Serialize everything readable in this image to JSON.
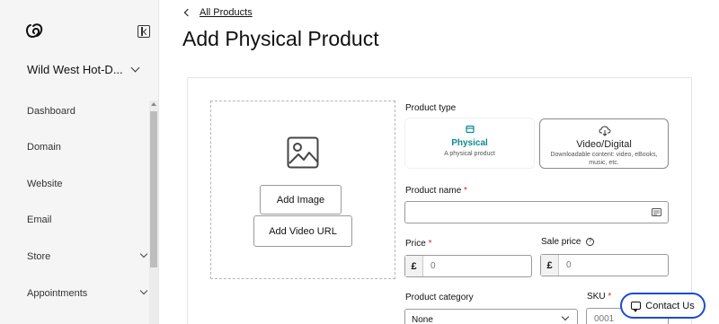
{
  "sidebar": {
    "site_name": "Wild West Hot-D...",
    "items": [
      {
        "label": "Dashboard"
      },
      {
        "label": "Domain"
      },
      {
        "label": "Website"
      },
      {
        "label": "Email"
      },
      {
        "label": "Store"
      },
      {
        "label": "Appointments"
      }
    ]
  },
  "breadcrumb": {
    "back_label": "All Products"
  },
  "page": {
    "title": "Add Physical Product"
  },
  "media": {
    "add_image_label": "Add Image",
    "add_video_label": "Add Video URL"
  },
  "product_type": {
    "label": "Product type",
    "options": [
      {
        "title": "Physical",
        "subtitle": "A physical product",
        "selected": true
      },
      {
        "title": "Video/Digital",
        "subtitle": "Downloadable content: video, eBooks, music, etc.",
        "selected": false
      }
    ]
  },
  "product_name": {
    "label": "Product name",
    "required_mark": "*",
    "value": ""
  },
  "price": {
    "label": "Price",
    "required_mark": "*",
    "currency": "£",
    "placeholder": "0"
  },
  "sale_price": {
    "label": "Sale price",
    "currency": "£",
    "placeholder": "0"
  },
  "category": {
    "label": "Product category",
    "selected": "None"
  },
  "sku": {
    "label": "SKU",
    "required_mark": "*",
    "placeholder": "0001"
  },
  "contact": {
    "label": "Contact Us"
  },
  "colors": {
    "accent": "#0d8a8d",
    "contact_border": "#1a4bd6",
    "required": "#d12b2b"
  }
}
